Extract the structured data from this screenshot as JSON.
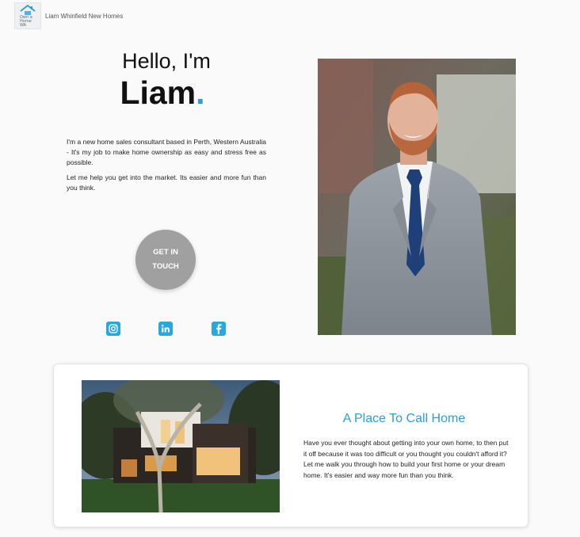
{
  "header": {
    "logo_text": "Own a\nHome\nWA",
    "site_name": "Liam Whinfield New Homes"
  },
  "hero": {
    "greeting": "Hello, I'm",
    "name": "Liam",
    "name_dot": ".",
    "intro_paragraphs": [
      "I'm a new home sales consultant based in Perth, Western Australia - It's my job to make home ownership as easy and stress free as possible.",
      "Let me help you get into the market. Its easier and more fun than you think."
    ],
    "cta_label": "GET IN TOUCH"
  },
  "social": [
    {
      "name": "instagram-icon"
    },
    {
      "name": "linkedin-icon"
    },
    {
      "name": "facebook-icon"
    }
  ],
  "feature": {
    "title": "A Place To Call Home",
    "body": "Have you ever thought about getting into your own home, to then put it off because it was too difficult or you thought you couldn't afford it? Let me walk you through how to build your first home or your dream home. It's easier and way more fun than you think."
  },
  "colors": {
    "accent": "#2a9fd8",
    "social": "#29a7e1",
    "cta": "#a0a0a0"
  }
}
